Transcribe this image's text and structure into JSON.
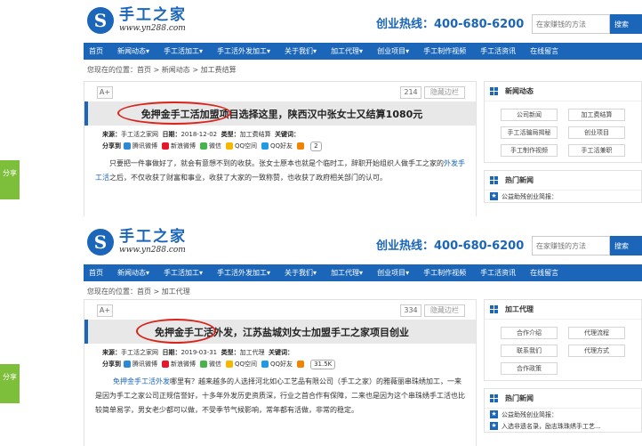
{
  "site": {
    "logo_title": "手工之家",
    "logo_url": "www.yn288.com",
    "hotline_label": "创业热线：",
    "hotline_number": "400-680-6200",
    "search_placeholder": "在家赚钱的方法",
    "search_button": "搜索",
    "nav": [
      "首页",
      "新闻动态▾",
      "手工活加工▾",
      "手工活外发加工▾",
      "关于我们▾",
      "加工代理▾",
      "创业项目▾",
      "手工制作视频",
      "手工活资讯",
      "在线留言"
    ],
    "share_tab": "分享"
  },
  "toolbar": {
    "font_button": "A+",
    "sidebar_toggle": "隐藏边栏"
  },
  "meta_labels": {
    "source": "来源：",
    "date": "日期：",
    "category": "类型：",
    "keywords": "关键词：",
    "share": "分享到"
  },
  "share_services": [
    "腾讯微博",
    "新浪微博",
    "微信",
    "QQ空间",
    "QQ好友"
  ],
  "shot1": {
    "breadcrumb": "您现在的位置：首页 > 新闻动态 > 加工费结算",
    "views": "214",
    "title": "免押金手工活加盟项目选择这里，陕西汉中张女士又结算1080元",
    "source": "手工活之家网",
    "date": "2018-12-02",
    "category": "加工费结算",
    "share_count": "2",
    "body_1": "只要把一件事做好了，就会有意想不到的收获。张女士原本也就是个临时工，辞职开始组织人做手工之家的",
    "body_link": "外发手工活",
    "body_2": "之后，不仅收获了财富和事业，收获了大家的一致称赞，也收获了政府相关部门的认可。",
    "side_title_1": "新闻动态",
    "side_tags": [
      "公司新闻",
      "加工费结算",
      "手工活骗局揭秘",
      "创业项目",
      "手工制作视频",
      "手工活兼职"
    ],
    "side_title_2": "热门新闻",
    "hot_items": [
      "公益助残创业简报："
    ]
  },
  "shot2": {
    "breadcrumb": "您现在的位置：首页 > 加工代理",
    "views": "334",
    "title": "免押金手工活外发，江苏盐城刘女士加盟手工之家项目创业",
    "source": "手工活之家网",
    "date": "2019-03-31",
    "category": "加工代理",
    "share_count": "31.5K",
    "body_link": "免押金手工活外发",
    "body_1": "哪里有？越来越多的人选择河北如心工艺品有限公司（手工之家）的雅薇丽串珠绣加工，一来是因为手工之家公司正规信誉好，十多年外发历史资质深，行业之首合作有保障，二来也是因为这个串珠绣手工活也比较简单易学，男女老少都可以做，不受季节气候影响，常年都有活做，非常的稳定。",
    "side_title_1": "加工代理",
    "side_tags": [
      "合作介绍",
      "代理流程",
      "联系我们",
      "代理方式",
      "合作政策"
    ],
    "side_title_2": "热门新闻",
    "hot_items": [
      "公益助残创业简报：",
      "入选非遗名录，励志珠珠绣手工艺..."
    ]
  },
  "colors": {
    "brand_blue": "#1b66b8",
    "share_green": "#7dbf3a",
    "highlight_red": "#d9241c"
  }
}
